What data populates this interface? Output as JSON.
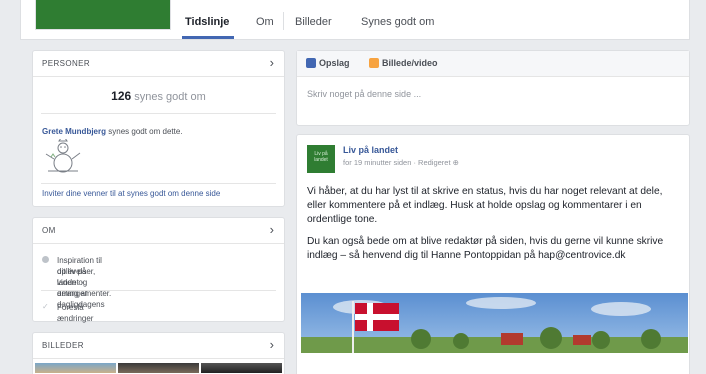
{
  "tabs": [
    {
      "label": "Tidslinje"
    },
    {
      "label": "Om"
    },
    {
      "label": "Billeder"
    },
    {
      "label": "Synes godt om"
    }
  ],
  "people": {
    "title": "PERSONER",
    "likes_count": "126",
    "likes_suffix": "synes godt om",
    "liker_name": "Grete Mundbjerg",
    "liker_text": "synes godt om dette.",
    "invite_text": "Inviter dine venner til at synes godt om denne side"
  },
  "about": {
    "title": "OM",
    "description": "Inspiration til dit liv på landet - deling af dagligdagens",
    "description_line2": "oplevelser, viden og arrangementer.",
    "suggest": "Foreslå ændringer"
  },
  "photos": {
    "title": "BILLEDER"
  },
  "composer": {
    "post_label": "Opslag",
    "photo_label": "Billede/video",
    "placeholder": "Skriv noget på denne side ..."
  },
  "post": {
    "avatar_text": "Liv på landet",
    "author": "Liv på landet",
    "meta": "for 19 minutter siden · Redigeret",
    "paragraph1": "Vi håber, at du har lyst til at skrive en status, hvis du har noget relevant at dele, eller kommentere på et indlæg. Husk at holde opslag og kommentarer i en ordentlige tone.",
    "paragraph2": "Du kan også bede om at blive redaktør på siden, hvis du gerne vil kunne skrive indlæg – så henvend dig til Hanne Pontoppidan på hap@centrovice.dk"
  },
  "colors": {
    "accent": "#4267b2",
    "link": "#385898",
    "brand_green": "#2f7d32"
  },
  "icons": {
    "chevron": "chevron-right-icon",
    "post": "pencil-icon",
    "photo": "photo-icon",
    "info": "info-icon",
    "suggest": "pencil-icon",
    "globe": "globe-icon"
  }
}
